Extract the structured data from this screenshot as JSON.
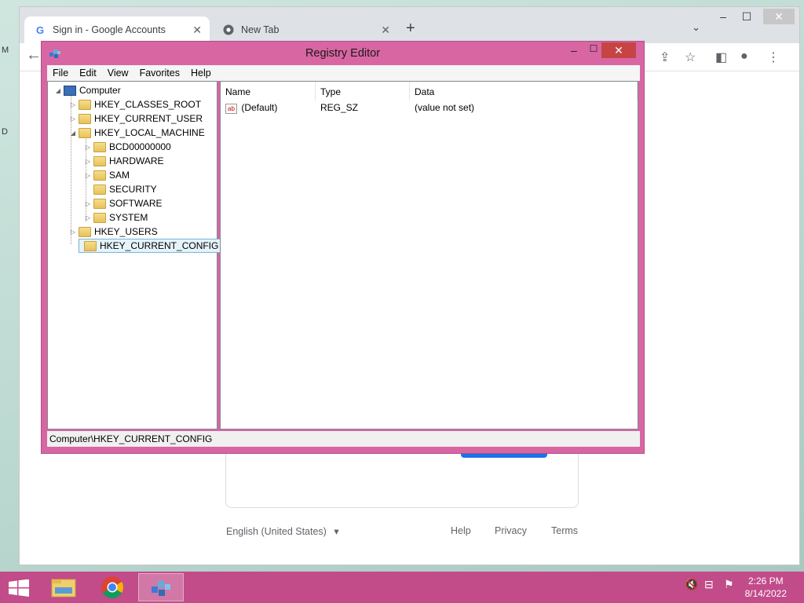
{
  "browser": {
    "tabs": [
      {
        "label": "Sign in - Google Accounts",
        "icon": "google-icon",
        "active": true
      },
      {
        "label": "New Tab",
        "icon": "chrome-icon",
        "active": false
      }
    ],
    "footer": {
      "language": "English (United States)",
      "links": [
        "Help",
        "Privacy",
        "Terms"
      ]
    }
  },
  "regedit": {
    "title": "Registry Editor",
    "menu": [
      "File",
      "Edit",
      "View",
      "Favorites",
      "Help"
    ],
    "tree": {
      "root": "Computer",
      "hives": [
        "HKEY_CLASSES_ROOT",
        "HKEY_CURRENT_USER",
        "HKEY_LOCAL_MACHINE",
        "HKEY_USERS",
        "HKEY_CURRENT_CONFIG"
      ],
      "hklm_children": [
        "BCD00000000",
        "HARDWARE",
        "SAM",
        "SECURITY",
        "SOFTWARE",
        "SYSTEM"
      ],
      "selected": "HKEY_CURRENT_CONFIG"
    },
    "columns": [
      "Name",
      "Type",
      "Data"
    ],
    "values": [
      {
        "name": "(Default)",
        "type": "REG_SZ",
        "data": "(value not set)"
      }
    ],
    "status": "Computer\\HKEY_CURRENT_CONFIG"
  },
  "taskbar": {
    "time": "2:26 PM",
    "date": "8/14/2022"
  },
  "colors": {
    "window_frame": "#d866a3",
    "taskbar": "#c24b8a"
  }
}
